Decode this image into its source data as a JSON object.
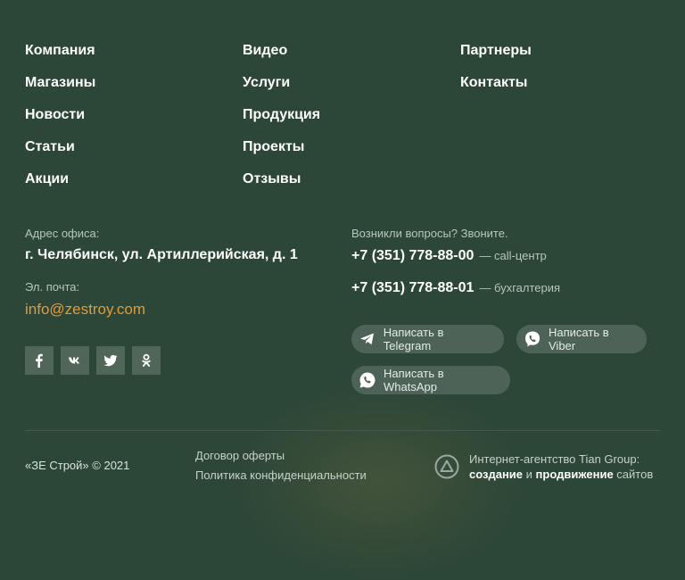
{
  "nav": {
    "col1": [
      "Компания",
      "Магазины",
      "Новости",
      "Статьи",
      "Акции"
    ],
    "col2": [
      "Видео",
      "Услуги",
      "Продукция",
      "Проекты",
      "Отзывы"
    ],
    "col3": [
      "Партнеры",
      "Контакты"
    ]
  },
  "office": {
    "label": "Адрес офиса:",
    "address": "г. Челябинск, ул. Артиллерийская, д. 1",
    "email_label": "Эл. почта:",
    "email": "info@zestroy.com"
  },
  "socials": [
    "facebook-icon",
    "vk-icon",
    "twitter-icon",
    "odnoklassniki-icon"
  ],
  "contacts": {
    "label": "Возникли вопросы? Звоните.",
    "phone1": "+7 (351) 778-88-00",
    "phone1_note": "— call-центр",
    "phone2": "+7 (351) 778-88-01",
    "phone2_note": "— бухгалтерия"
  },
  "messengers": {
    "telegram": "Написать в Telegram",
    "viber": "Написать в Viber",
    "whatsapp": "Написать в WhatsApp"
  },
  "bottom": {
    "copyright": "«ЗЕ Строй» © 2021",
    "offer": "Договор оферты",
    "privacy": "Политика конфиденциальности",
    "agency_line1": "Интернет-агентство Tian Group:",
    "agency_create": "создание",
    "agency_and": " и ",
    "agency_promo": "продвижение",
    "agency_sites": " сайтов"
  },
  "colors": {
    "background": "#2c4637",
    "accent": "#e39a37"
  }
}
